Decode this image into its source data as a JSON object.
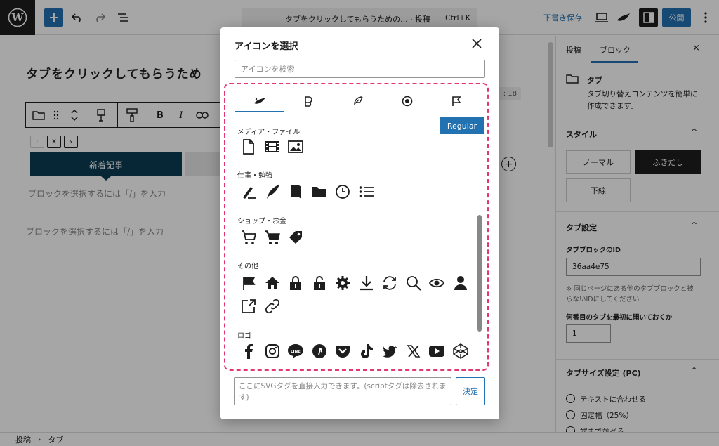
{
  "topbar": {
    "document_title": "タブをクリックしてもらうための... · 投稿",
    "shortcut": "Ctrl+K",
    "save_draft": "下書き保存",
    "publish": "公開"
  },
  "editor": {
    "post_title": "タブをクリックしてもらうため",
    "word_count": ": 18",
    "active_tab": "新着記事",
    "placeholder_1": "ブロックを選択するには「/」を入力",
    "placeholder_2": "ブロックを選択するには「/」を入力"
  },
  "sidebar": {
    "tabs": [
      "投稿",
      "ブロック"
    ],
    "block_name": "タブ",
    "block_desc_1": "タブ切り替えコンテンツを簡単に",
    "block_desc_2": "作成できます。",
    "style_heading": "スタイル",
    "style_options": [
      "ノーマル",
      "ふきだし",
      "下線"
    ],
    "tab_settings_heading": "タブ設定",
    "tab_block_id_label": "タブブロックのID",
    "tab_block_id_value": "36aa4e75",
    "id_note_1": "※ 同じページにある他のタブブロックと被",
    "id_note_2": "らないIDにしてください",
    "open_first_label": "何番目のタブを最初に開いておくか",
    "open_first_value": "1",
    "tab_size_heading": "タブサイズ設定 (PC)",
    "size_options": [
      "テキストに合わせる",
      "固定幅（25%）",
      "端まで並べる"
    ]
  },
  "breadcrumb": [
    "投稿",
    "タブ"
  ],
  "modal": {
    "title": "アイコンを選択",
    "search_placeholder": "アイコンを検索",
    "weight_button": "Regular",
    "categories": [
      "メディア・ファイル",
      "仕事・勉強",
      "ショップ・お金",
      "その他",
      "ロゴ"
    ],
    "svg_input_placeholder": "ここにSVGタグを直接入力できます。(scriptタグは除去されます)",
    "confirm_button": "決定"
  },
  "colors": {
    "accent": "#2271b1",
    "tab_active": "#0b3c54",
    "highlight": "#e2386f"
  }
}
